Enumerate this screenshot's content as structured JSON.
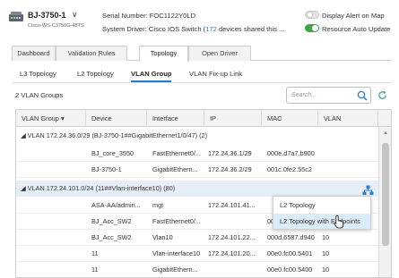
{
  "device": {
    "name": "BJ-3750-1",
    "model": "Cisco-WS-C3750G-48TS",
    "serial": "Serial Number: FOC1122Y0LD",
    "driver_prefix": "System Driver: Cisco IOS Switch (",
    "driver_count": "172",
    "driver_suffix": " devices shared this ..."
  },
  "toggles": [
    {
      "label": "Display Alert on Map",
      "on": false
    },
    {
      "label": "Resource Auto Update",
      "on": true
    }
  ],
  "main_tabs": [
    "Dashboard",
    "Validation Rules",
    "Topology",
    "Open Driver"
  ],
  "active_main_tab": "Topology",
  "sub_tabs": [
    "L3 Topology",
    "L2 Topology",
    "VLAN Group",
    "VLAN Fix-up Link"
  ],
  "active_sub_tab": "VLAN Group",
  "groups_count": "2 VLAN Groups",
  "search": {
    "placeholder": "Search..."
  },
  "columns": [
    "VLAN Group",
    "Device",
    "Interface",
    "IP",
    "MAC",
    "VLAN"
  ],
  "groups": [
    {
      "label": "VLAN 172.24.36.0/29 (BJ-3750-1##GigabitEthernet1/0/47) (2)",
      "rows": [
        {
          "device": "BJ_core_3550",
          "interface": "FastEthernet0/...",
          "ip": "172.24.36.1/29",
          "mac": "000e.d7a7.b900",
          "vlan": ""
        },
        {
          "device": "BJ-3750-1",
          "interface": "GigabitEthern...",
          "ip": "172.24.36.2/29",
          "mac": "001c.0fe2.55c2",
          "vlan": ""
        }
      ]
    },
    {
      "label": "VLAN 172.24.101.0/24 (11##Vlan-interface10) (80)",
      "rows": [
        {
          "device": "ASA-AA/admin...",
          "interface": "mgt",
          "ip": "172.24.101.41...",
          "mac": "",
          "vlan": ""
        },
        {
          "device": "BJ_Acc_SW2",
          "interface": "FastEthernet0/...",
          "ip": "",
          "mac": "00",
          "vlan": ""
        },
        {
          "device": "BJ_Acc_SW2",
          "interface": "Vlan10",
          "ip": "172.24.101.22...",
          "mac": "000d.6587.d940",
          "vlan": "10"
        },
        {
          "device": "11",
          "interface": "Vlan-interface10",
          "ip": "172.24.101.20...",
          "mac": "00e0.fc00.5401",
          "vlan": "10"
        },
        {
          "device": "11",
          "interface": "GigabitEthern...",
          "ip": "",
          "mac": "00e0.fc00.5400",
          "vlan": "10"
        }
      ]
    }
  ],
  "context_menu": [
    "L2 Topology",
    "L2 Topology with Endpoints"
  ],
  "colors": {
    "accent": "#2a7bd0",
    "toggle_on": "#3aa84b",
    "link": "#1f7cc8",
    "highlight": "#e6eff7"
  }
}
